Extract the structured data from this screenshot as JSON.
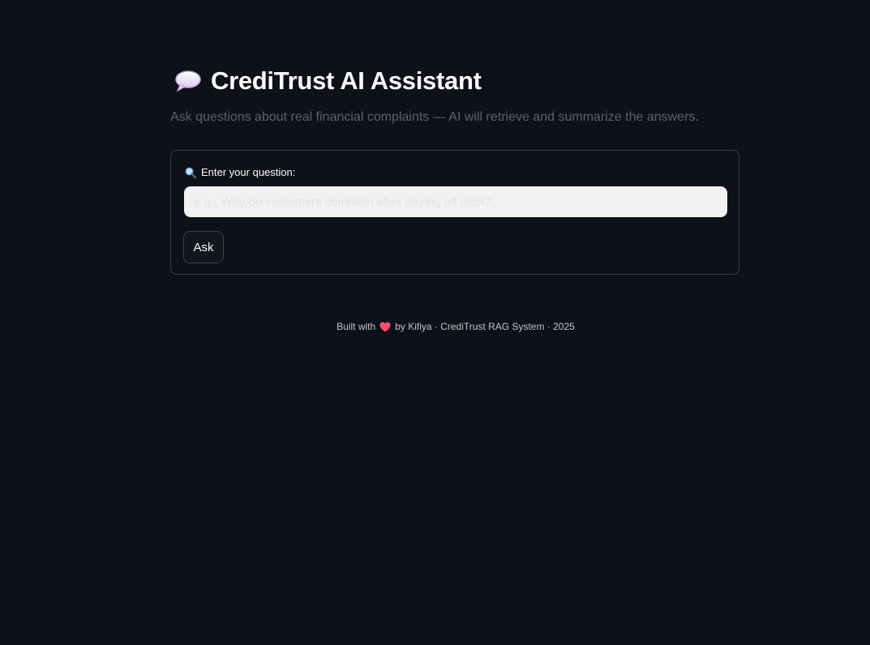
{
  "header": {
    "title": "CrediTrust AI Assistant",
    "title_icon": "speech-bubble-icon",
    "subtitle": "Ask questions about real financial complaints — AI will retrieve and summarize the answers."
  },
  "form": {
    "label": "Enter your question:",
    "label_icon": "magnifying-glass-icon",
    "input_placeholder": "e.g., Why do customers complain after paying off debt?",
    "input_value": "",
    "ask_label": "Ask"
  },
  "footer": {
    "prefix": "Built with",
    "heart_icon": "heart-icon",
    "suffix": "by Kifiya · CrediTrust RAG System · 2025"
  },
  "colors": {
    "background": "#0e1117",
    "accent_heart": "#ff4b6e",
    "input_background": "#f2f1f1",
    "border": "#3a3d45"
  }
}
